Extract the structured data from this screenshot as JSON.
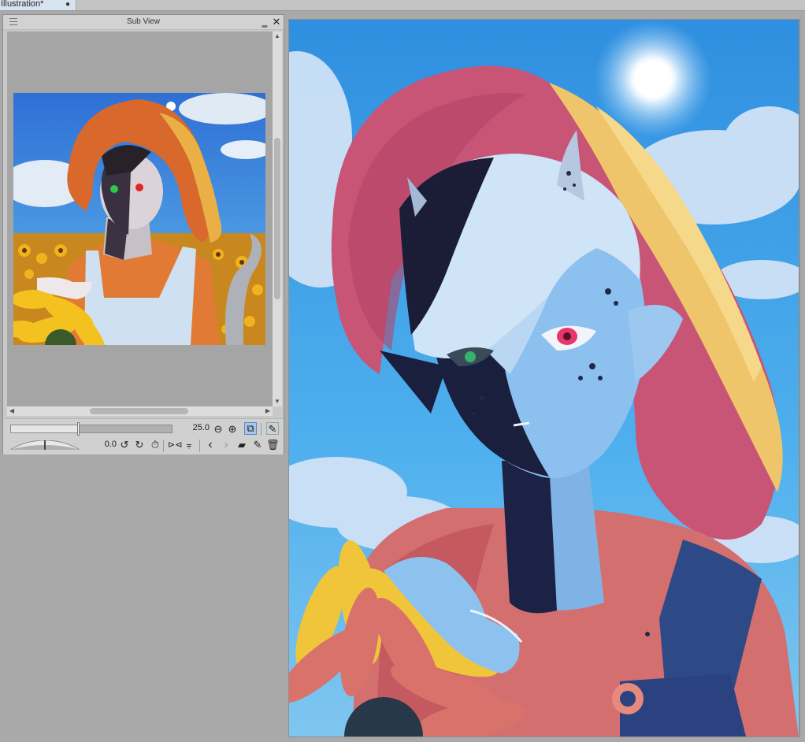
{
  "tab": {
    "title": "Illustration*",
    "modified_marker": "●"
  },
  "sub_view": {
    "title": "Sub View",
    "zoom_value": "25.0",
    "zoom_level_fraction": 0.42,
    "rotation_value": "0.0",
    "rotation_level_fraction": 0.5
  },
  "icons": {
    "menu": "grip-icon",
    "minimize": "minimize-icon",
    "close": "close-icon",
    "zoom_out": "zoom-out-icon",
    "zoom_in": "zoom-in-icon",
    "fit": "fit-view-icon",
    "eyedropper": "eyedropper-icon",
    "rotate_left": "rotate-left-icon",
    "rotate_right": "rotate-right-icon",
    "reset_rotation": "reset-rotation-icon",
    "flip_horizontal": "flip-horizontal-icon",
    "flip_vertical": "flip-vertical-icon",
    "previous": "previous-image-icon",
    "next": "next-image-icon",
    "import": "import-image-icon",
    "clear": "clear-image-icon",
    "delete": "delete-icon"
  },
  "colors": {
    "panel_bg": "#c9c9c9",
    "workspace_bg": "#a9a9a9",
    "active_button": "#a9c6e6",
    "tab_active": "#d7e3ef"
  }
}
